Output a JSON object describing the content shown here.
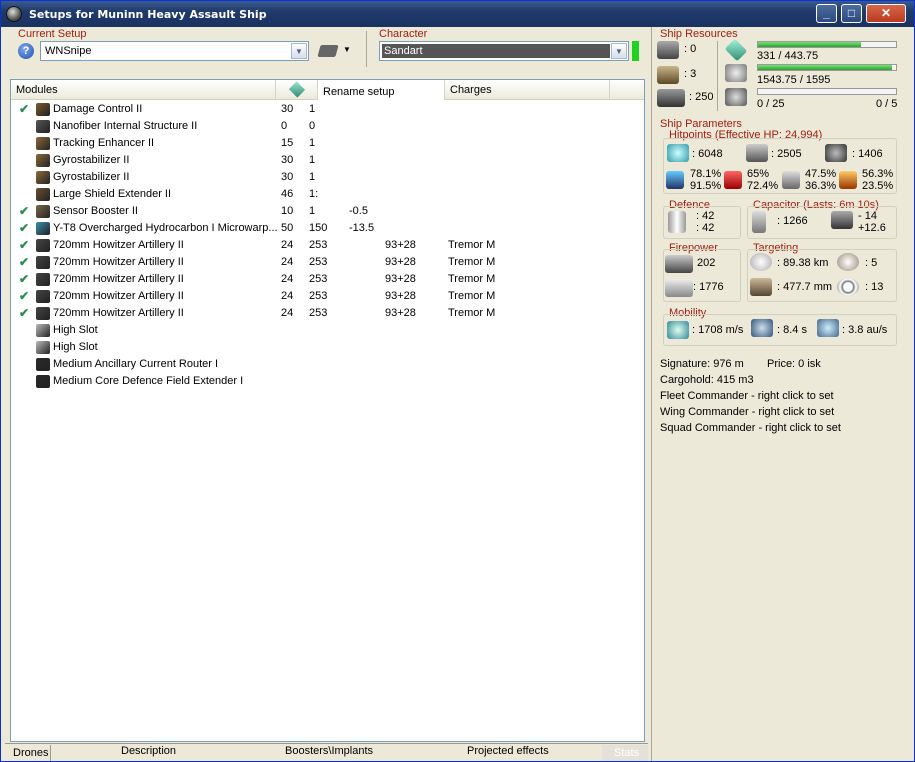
{
  "window": {
    "title": "Setups for Muninn Heavy Assault Ship"
  },
  "setup": {
    "label": "Current Setup",
    "value": "WNSnipe"
  },
  "character": {
    "label": "Character",
    "value": "Sandart"
  },
  "columns": {
    "modules": "Modules",
    "rename": "Rename setup",
    "charges": "Charges"
  },
  "modules": [
    {
      "checked": true,
      "name": "Damage Control II",
      "c1": "30",
      "c2": "1",
      "c3": "",
      "c4": "",
      "charge": "",
      "color": "#7A5C2E"
    },
    {
      "checked": false,
      "name": "Nanofiber Internal Structure II",
      "c1": "0",
      "c2": "0",
      "c3": "",
      "c4": "",
      "charge": "",
      "color": "#555555"
    },
    {
      "checked": false,
      "name": "Tracking Enhancer II",
      "c1": "15",
      "c2": "1",
      "c3": "",
      "c4": "",
      "charge": "",
      "color": "#8B6A3A"
    },
    {
      "checked": false,
      "name": "Gyrostabilizer II",
      "c1": "30",
      "c2": "1",
      "c3": "",
      "c4": "",
      "charge": "",
      "color": "#8B6A3A"
    },
    {
      "checked": false,
      "name": "Gyrostabilizer II",
      "c1": "30",
      "c2": "1",
      "c3": "",
      "c4": "",
      "charge": "",
      "color": "#8B6A3A"
    },
    {
      "checked": false,
      "name": "Large Shield Extender II",
      "c1": "46",
      "c2": "1:",
      "c3": "",
      "c4": "",
      "charge": "",
      "color": "#6B5030"
    },
    {
      "checked": true,
      "name": "Sensor Booster II",
      "c1": "10",
      "c2": "1",
      "c3": "-0.5",
      "c4": "",
      "charge": "",
      "color": "#7A6A4A"
    },
    {
      "checked": true,
      "name": "Y-T8 Overcharged Hydrocarbon I Microwarp...",
      "c1": "50",
      "c2": "150",
      "c3": "-13.5",
      "c4": "",
      "charge": "",
      "color": "#3A8FB0"
    },
    {
      "checked": true,
      "name": "720mm Howitzer Artillery II",
      "c1": "24",
      "c2": "253",
      "c3": "",
      "c4": "93+28",
      "charge": "Tremor M",
      "color": "#444444"
    },
    {
      "checked": true,
      "name": "720mm Howitzer Artillery II",
      "c1": "24",
      "c2": "253",
      "c3": "",
      "c4": "93+28",
      "charge": "Tremor M",
      "color": "#444444"
    },
    {
      "checked": true,
      "name": "720mm Howitzer Artillery II",
      "c1": "24",
      "c2": "253",
      "c3": "",
      "c4": "93+28",
      "charge": "Tremor M",
      "color": "#444444"
    },
    {
      "checked": true,
      "name": "720mm Howitzer Artillery II",
      "c1": "24",
      "c2": "253",
      "c3": "",
      "c4": "93+28",
      "charge": "Tremor M",
      "color": "#444444"
    },
    {
      "checked": true,
      "name": "720mm Howitzer Artillery II",
      "c1": "24",
      "c2": "253",
      "c3": "",
      "c4": "93+28",
      "charge": "Tremor M",
      "color": "#444444"
    },
    {
      "checked": false,
      "name": "High Slot",
      "c1": "",
      "c2": "",
      "c3": "",
      "c4": "",
      "charge": "",
      "color": "#BBBBBB"
    },
    {
      "checked": false,
      "name": "High Slot",
      "c1": "",
      "c2": "",
      "c3": "",
      "c4": "",
      "charge": "",
      "color": "#BBBBBB"
    },
    {
      "checked": false,
      "name": "Medium Ancillary Current Router I",
      "c1": "",
      "c2": "",
      "c3": "",
      "c4": "",
      "charge": "",
      "color": "#2A2A2A"
    },
    {
      "checked": false,
      "name": "Medium Core Defence Field Extender I",
      "c1": "",
      "c2": "",
      "c3": "",
      "c4": "",
      "charge": "",
      "color": "#2A2A2A"
    }
  ],
  "tabs": [
    "Drones",
    "Description",
    "Boosters\\Implants",
    "Projected effects",
    "Stats"
  ],
  "resources": {
    "label": "Ship Resources",
    "turret": ": 0",
    "launcher": ": 3",
    "drone_bay": ": 250",
    "cpu": "331 / 443.75",
    "cpu_fraction": 0.746,
    "power": "1543.75 / 1595",
    "power_fraction": 0.968,
    "calibration": "0 / 25",
    "calibration_fraction": 0,
    "rigs": "0 / 5"
  },
  "params": {
    "label": "Ship Parameters",
    "hp_label": "Hitpoints (Effective HP: 24,994)",
    "shield_hp": ": 6048",
    "armor_hp": ": 2505",
    "hull_hp": ": 1406",
    "em": "78.1%",
    "em2": "91.5%",
    "thermal": "65%",
    "thermal2": "72.4%",
    "kinetic": "47.5%",
    "kinetic2": "36.3%",
    "explosive": "56.3%",
    "explosive2": "23.5%",
    "defence_label": "Defence",
    "def1": ": 42",
    "def2": ": 42",
    "capacitor_label": "Capacitor (Lasts: 6m 10s)",
    "cap_amount": ": 1266",
    "cap1": "- 14",
    "cap2": "+12.6",
    "firepower_label": "Firepower",
    "dps": "202",
    "volley": ": 1776",
    "targeting_label": "Targeting",
    "range": ": 89.38 km",
    "max_targets": ": 5",
    "scan_res": ": 477.7 mm",
    "sensor": ": 13",
    "mobility_label": "Mobility",
    "speed": ": 1708 m/s",
    "align": ": 8.4 s",
    "warp": ": 3.8 au/s"
  },
  "info": {
    "signature": "Signature: 976 m",
    "price": "Price: 0 isk",
    "cargo": "Cargohold: 415 m3",
    "fleet": "Fleet Commander - right click to set",
    "wing": "Wing Commander - right click to set",
    "squad": "Squad Commander - right click to set"
  }
}
